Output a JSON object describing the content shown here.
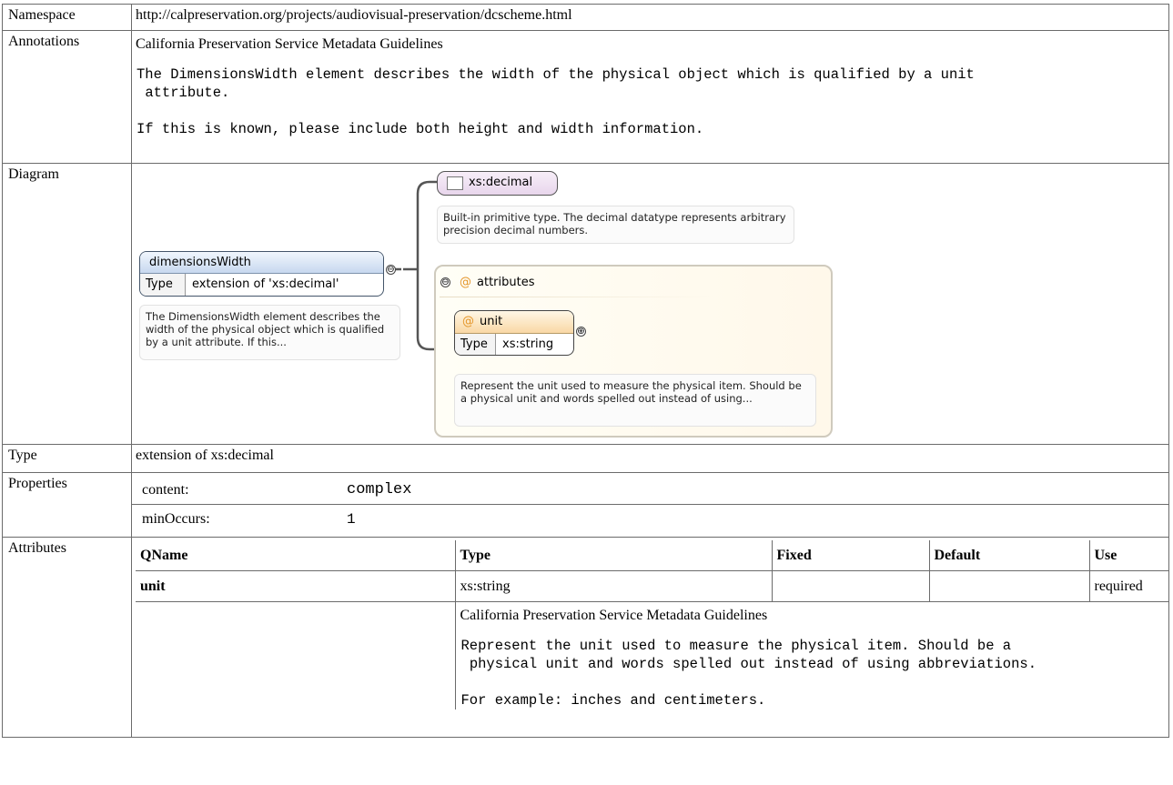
{
  "namespace": {
    "label": "Namespace",
    "value": "http://calpreservation.org/projects/audiovisual-preservation/dcscheme.html"
  },
  "annotations": {
    "label": "Annotations",
    "title": "California Preservation Service Metadata Guidelines",
    "text": "The DimensionsWidth element describes the width of the physical object which is qualified by a unit\n attribute.\n\nIf this is known, please include both height and width information."
  },
  "diagram": {
    "label": "Diagram",
    "element_name": "dimensionsWidth",
    "element_type_key": "Type",
    "element_type_value": "extension of 'xs:decimal'",
    "element_note": "The DimensionsWidth element describes the width of the physical object which is qualified by a unit attribute. If this...",
    "base_type": "xs:decimal",
    "base_type_note": "Built-in primitive type. The decimal datatype represents arbitrary precision decimal numbers.",
    "attributes_group": "attributes",
    "attribute_name": "unit",
    "attribute_type_key": "Type",
    "attribute_type_value": "xs:string",
    "attribute_note": "Represent the unit used to measure the physical item. Should be a physical unit and words spelled out instead of using...",
    "collapse_glyph": "⊖",
    "expand_glyph": "⊕",
    "at_glyph": "@"
  },
  "type": {
    "label": "Type",
    "value": "extension of xs:decimal"
  },
  "properties": {
    "label": "Properties",
    "rows": [
      {
        "key": "content:",
        "value": "complex"
      },
      {
        "key": "minOccurs:",
        "value": "1"
      }
    ]
  },
  "attributes": {
    "label": "Attributes",
    "headers": [
      "QName",
      "Type",
      "Fixed",
      "Default",
      "Use"
    ],
    "rows": [
      {
        "qname": "unit",
        "type": "xs:string",
        "fixed": "",
        "default": "",
        "use": "required"
      }
    ],
    "doc_title": "California Preservation Service Metadata Guidelines",
    "doc_text": "Represent the unit used to measure the physical item. Should be a\n physical unit and words spelled out instead of using abbreviations.\n\nFor example: inches and centimeters."
  }
}
